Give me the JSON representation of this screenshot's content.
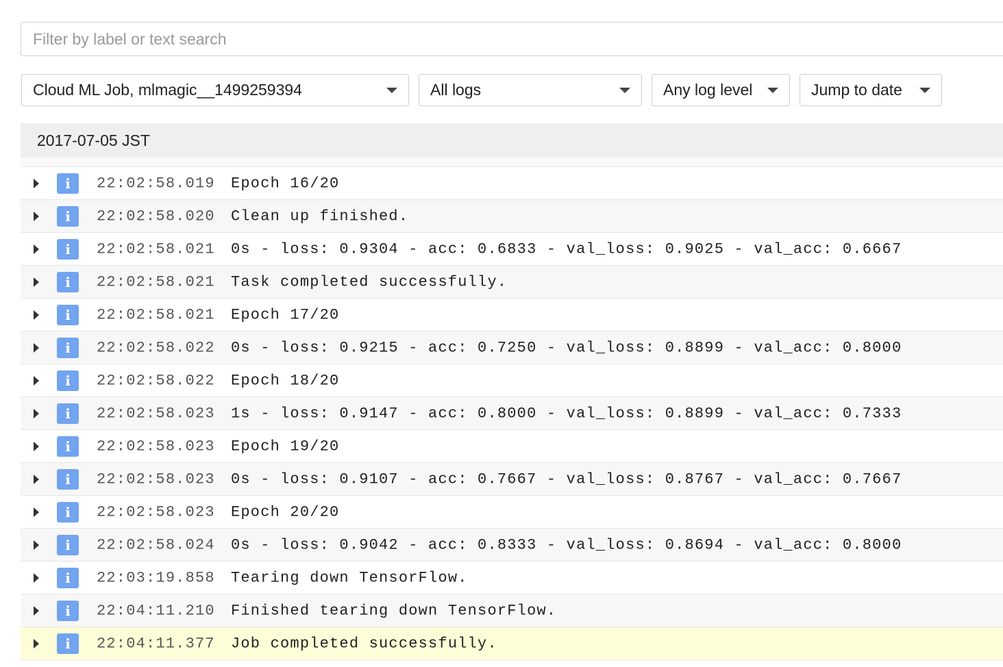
{
  "search": {
    "placeholder": "Filter by label or text search",
    "value": ""
  },
  "filters": {
    "resource": "Cloud ML Job, mlmagic__1499259394",
    "log_name": "All logs",
    "log_level": "Any log level",
    "jump": "Jump to date"
  },
  "date_header": "2017-07-05 JST",
  "severity_icon": "info-icon",
  "severity_glyph": "i",
  "colors": {
    "info_badge": "#72a4ef",
    "highlight_row": "#fdfdd8"
  },
  "rows": [
    {
      "time": "22:02:58.019",
      "message": "Epoch 16/20"
    },
    {
      "time": "22:02:58.020",
      "message": "Clean up finished."
    },
    {
      "time": "22:02:58.021",
      "message": "0s - loss: 0.9304 - acc: 0.6833 - val_loss: 0.9025 - val_acc: 0.6667"
    },
    {
      "time": "22:02:58.021",
      "message": "Task completed successfully."
    },
    {
      "time": "22:02:58.021",
      "message": "Epoch 17/20"
    },
    {
      "time": "22:02:58.022",
      "message": "0s - loss: 0.9215 - acc: 0.7250 - val_loss: 0.8899 - val_acc: 0.8000"
    },
    {
      "time": "22:02:58.022",
      "message": "Epoch 18/20"
    },
    {
      "time": "22:02:58.023",
      "message": "1s - loss: 0.9147 - acc: 0.8000 - val_loss: 0.8899 - val_acc: 0.7333"
    },
    {
      "time": "22:02:58.023",
      "message": "Epoch 19/20"
    },
    {
      "time": "22:02:58.023",
      "message": "0s - loss: 0.9107 - acc: 0.7667 - val_loss: 0.8767 - val_acc: 0.7667"
    },
    {
      "time": "22:02:58.023",
      "message": "Epoch 20/20"
    },
    {
      "time": "22:02:58.024",
      "message": "0s - loss: 0.9042 - acc: 0.8333 - val_loss: 0.8694 - val_acc: 0.8000"
    },
    {
      "time": "22:03:19.858",
      "message": "Tearing down TensorFlow."
    },
    {
      "time": "22:04:11.210",
      "message": "Finished tearing down TensorFlow."
    },
    {
      "time": "22:04:11.377",
      "message": "Job completed successfully."
    }
  ]
}
